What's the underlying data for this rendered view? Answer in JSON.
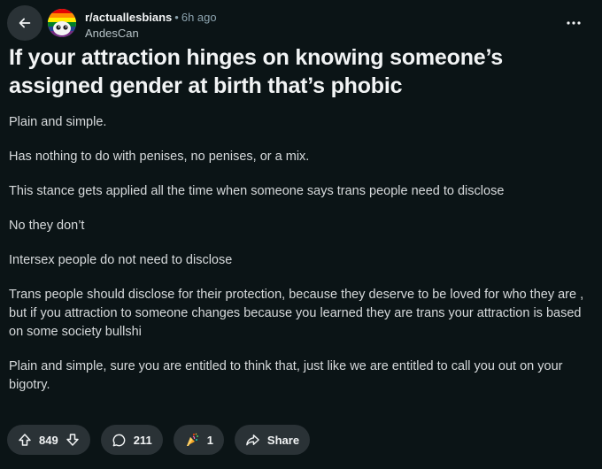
{
  "header": {
    "subreddit": "r/actuallesbians",
    "separator": "•",
    "time": "6h ago",
    "author": "AndesCan"
  },
  "post": {
    "title": "If your attraction hinges on knowing someone’s assigned gender at birth that’s phobic",
    "paragraphs": [
      "Plain and simple.",
      "Has nothing to do with penises, no penises, or a mix.",
      "This stance gets applied all the time when someone says trans people need to disclose",
      "No they don’t",
      "Intersex people do not need to disclose",
      "Trans people should disclose for their protection, because they deserve to be loved for who they are , but if you attraction to someone changes because you learned they are trans your attraction is based on some society bullshi",
      "Plain and simple, sure you are entitled to think that, just like we are entitled to call you out on your bigotry."
    ]
  },
  "actions": {
    "votes": "849",
    "comments": "211",
    "awards": "1",
    "share_label": "Share"
  },
  "icons": {
    "back": "arrow-left-icon",
    "more": "more-horizontal-icon",
    "upvote": "upvote-arrow-icon",
    "downvote": "downvote-arrow-icon",
    "comment": "comment-bubble-icon",
    "award": "award-icon",
    "share": "share-arrow-icon"
  },
  "colors": {
    "background": "#0b1416",
    "pill": "#2a3236",
    "text": "#d7dadc",
    "muted": "#8ba2ad"
  }
}
